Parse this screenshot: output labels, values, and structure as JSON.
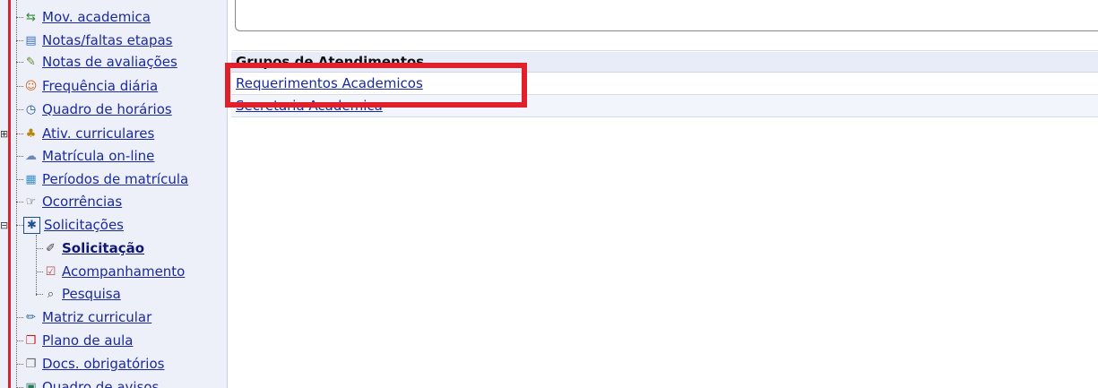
{
  "sidebar": {
    "items": [
      {
        "label": "Mov. academica",
        "icon": "arrows-icon"
      },
      {
        "label": "Notas/faltas etapas",
        "icon": "table-icon"
      },
      {
        "label": "Notas de avaliações",
        "icon": "feather-icon"
      },
      {
        "label": "Frequência diária",
        "icon": "calendar-person-icon"
      },
      {
        "label": "Quadro de horários",
        "icon": "clock-icon"
      },
      {
        "label": "Ativ. curriculares",
        "icon": "people-icon"
      },
      {
        "label": "Matrícula on-line",
        "icon": "cloud-icon"
      },
      {
        "label": "Períodos de matrícula",
        "icon": "calendar-icon"
      },
      {
        "label": "Ocorrências",
        "icon": "hand-icon"
      },
      {
        "label": "Solicitações",
        "icon": "request-icon"
      },
      {
        "label": "Solicitação",
        "icon": "pen-icon"
      },
      {
        "label": "Acompanhamento",
        "icon": "checklist-icon"
      },
      {
        "label": "Pesquisa",
        "icon": "magnifier-icon"
      },
      {
        "label": "Matriz curricular",
        "icon": "ruler-icon"
      },
      {
        "label": "Plano de aula",
        "icon": "book-icon"
      },
      {
        "label": "Docs. obrigatórios",
        "icon": "documents-icon"
      },
      {
        "label": "Quadro de avisos",
        "icon": "board-icon"
      }
    ]
  },
  "groups": {
    "header": "Grupos de Atendimentos",
    "rows": [
      "Requerimentos Academicos",
      "Secretaria Academica"
    ]
  },
  "colors": {
    "highlight": "#e0202a",
    "link": "#1a2a9c"
  }
}
